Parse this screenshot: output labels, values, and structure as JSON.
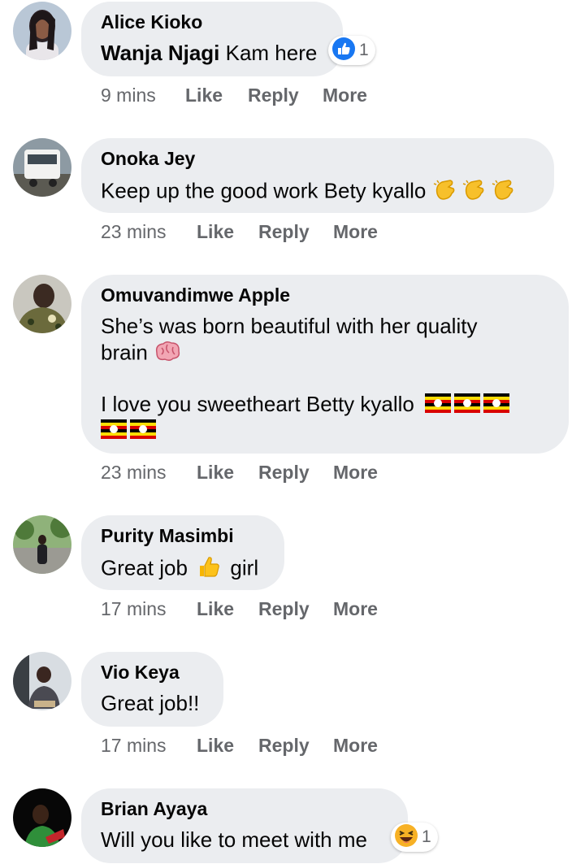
{
  "comments": [
    {
      "author": "Alice Kioko",
      "mention": "Wanja Njagi",
      "text": "Kam here",
      "time": "9 mins",
      "reaction_count": "1",
      "reaction_icon": "like-icon"
    },
    {
      "author": "Onoka Jey",
      "text": "Keep up the good work Bety kyallo",
      "emojis": [
        "clapping-hands-icon",
        "clapping-hands-icon",
        "clapping-hands-icon"
      ],
      "time": "23 mins"
    },
    {
      "author": "Omuvandimwe Apple",
      "text_line1": "She’s was born beautiful with her quality",
      "text_line2": "brain",
      "text_line3": "I love you sweetheart Betty kyallo",
      "emojis": [
        "brain-icon",
        "uganda-flag-icon"
      ],
      "time": "23 mins"
    },
    {
      "author": "Purity Masimbi",
      "text_before": "Great job",
      "text_after": "girl",
      "emojis": [
        "thumbs-up-icon"
      ],
      "time": "17 mins"
    },
    {
      "author": "Vio Keya",
      "text": "Great job!!",
      "time": "17 mins"
    },
    {
      "author": "Brian Ayaya",
      "text": "Will you like to meet with me",
      "reaction_count": "1",
      "reaction_icon": "laughing-face-icon"
    }
  ],
  "actions": {
    "like": "Like",
    "reply": "Reply",
    "more": "More"
  },
  "colors": {
    "bubble": "#ebedf0",
    "meta_text": "#65676b",
    "like_blue": "#1877f2"
  }
}
